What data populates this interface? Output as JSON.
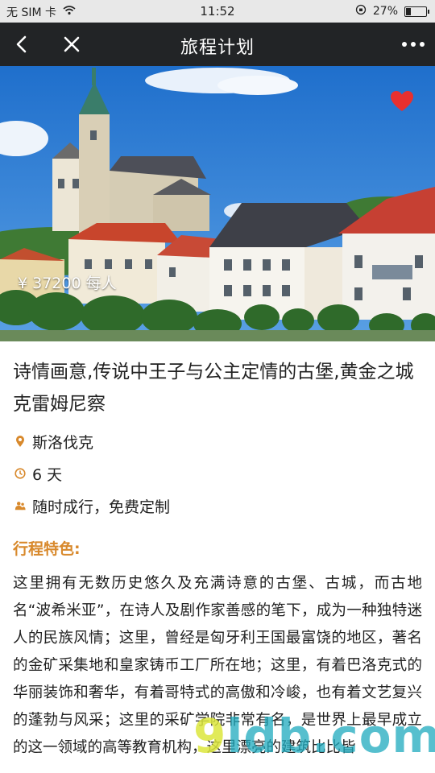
{
  "status": {
    "carrier": "无 SIM 卡",
    "time": "11:52",
    "battery_text": "27%",
    "battery_level": 0.27
  },
  "nav": {
    "title": "旅程计划",
    "back_icon": "chevron-left-icon",
    "close_icon": "close-icon",
    "more_icon": "more-dots-icon"
  },
  "hero": {
    "price": "¥ 37200 每人",
    "favorite_icon": "heart-icon",
    "favorite_color": "#e8302f"
  },
  "trip": {
    "title": "诗情画意,传说中王子与公主定情的古堡,黄金之城克雷姆尼察",
    "location": "斯洛伐克",
    "duration": "6 天",
    "mode": "随时成行，免费定制"
  },
  "features": {
    "heading": "行程特色:",
    "accent_color": "#d8892c",
    "body": "这里拥有无数历史悠久及充满诗意的古堡、古城，而古地名“波希米亚”，在诗人及剧作家善感的笔下，成为一种独特迷人的民族风情；这里，曾经是匈牙利王国最富饶的地区，著名的金矿采集地和皇家铸币工厂所在地；这里，有着巴洛克式的华丽装饰和奢华，有着哥特式的高傲和冷峻，也有着文艺复兴的蓬勃与风采；这里的采矿学院非常有名，是世界上最早成立的这一领域的高等教育机构，这里漂亮的建筑比比皆"
  },
  "watermark": {
    "text": "9ldb.com"
  }
}
